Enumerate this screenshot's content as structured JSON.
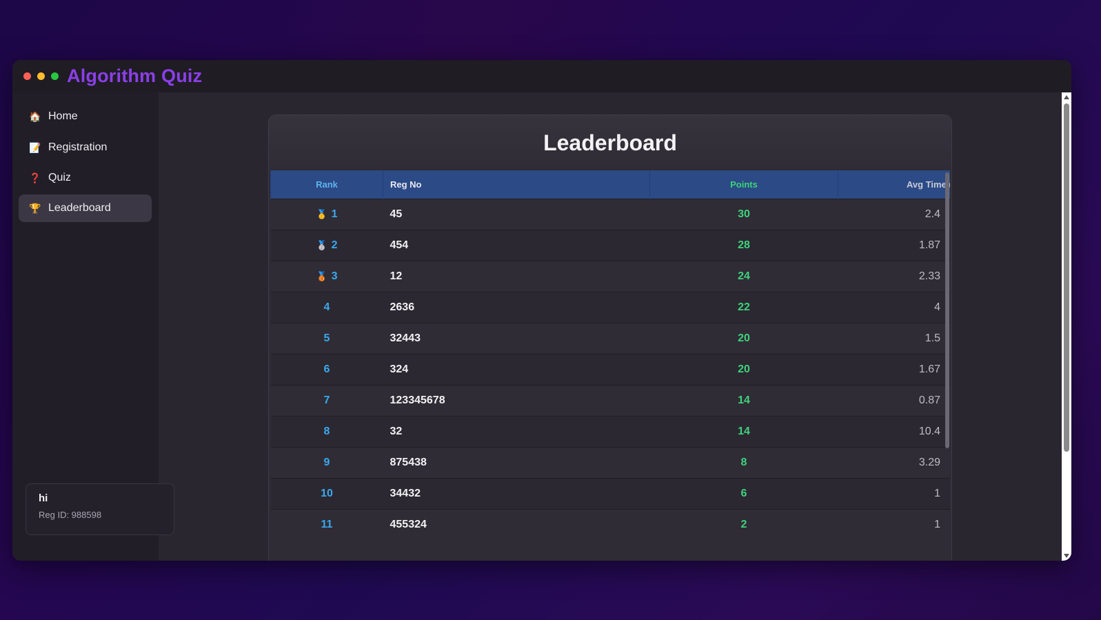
{
  "app": {
    "title": "Algorithm Quiz"
  },
  "sidebar": {
    "items": [
      {
        "icon": "home-icon",
        "glyph": "🏠",
        "label": "Home"
      },
      {
        "icon": "registration-icon",
        "glyph": "📝",
        "label": "Registration"
      },
      {
        "icon": "question-icon",
        "glyph": "❓",
        "label": "Quiz"
      },
      {
        "icon": "trophy-icon",
        "glyph": "🏆",
        "label": "Leaderboard"
      }
    ],
    "active": "Leaderboard"
  },
  "user": {
    "name": "hi",
    "reg_id": "Reg ID: 988598"
  },
  "leaderboard": {
    "title": "Leaderboard",
    "columns": {
      "rank": "Rank",
      "reg_no": "Reg No",
      "points": "Points",
      "avg_time": "Avg Time (s"
    },
    "rows": [
      {
        "medal": "🥇",
        "rank": "1",
        "reg_no": "45",
        "points": "30",
        "avg_time": "2.4"
      },
      {
        "medal": "🥈",
        "rank": "2",
        "reg_no": "454",
        "points": "28",
        "avg_time": "1.87"
      },
      {
        "medal": "🥉",
        "rank": "3",
        "reg_no": "12",
        "points": "24",
        "avg_time": "2.33"
      },
      {
        "medal": "",
        "rank": "4",
        "reg_no": "2636",
        "points": "22",
        "avg_time": "4"
      },
      {
        "medal": "",
        "rank": "5",
        "reg_no": "32443",
        "points": "20",
        "avg_time": "1.5"
      },
      {
        "medal": "",
        "rank": "6",
        "reg_no": "324",
        "points": "20",
        "avg_time": "1.67"
      },
      {
        "medal": "",
        "rank": "7",
        "reg_no": "123345678",
        "points": "14",
        "avg_time": "0.87"
      },
      {
        "medal": "",
        "rank": "8",
        "reg_no": "32",
        "points": "14",
        "avg_time": "10.4"
      },
      {
        "medal": "",
        "rank": "9",
        "reg_no": "875438",
        "points": "8",
        "avg_time": "3.29"
      },
      {
        "medal": "",
        "rank": "10",
        "reg_no": "34432",
        "points": "6",
        "avg_time": "1"
      },
      {
        "medal": "",
        "rank": "11",
        "reg_no": "455324",
        "points": "2",
        "avg_time": "1"
      }
    ]
  },
  "colors": {
    "accent": "#8b3fe8",
    "rank": "#3aa9ee",
    "points": "#3fd27d",
    "header_bg": "#2b4a86"
  }
}
